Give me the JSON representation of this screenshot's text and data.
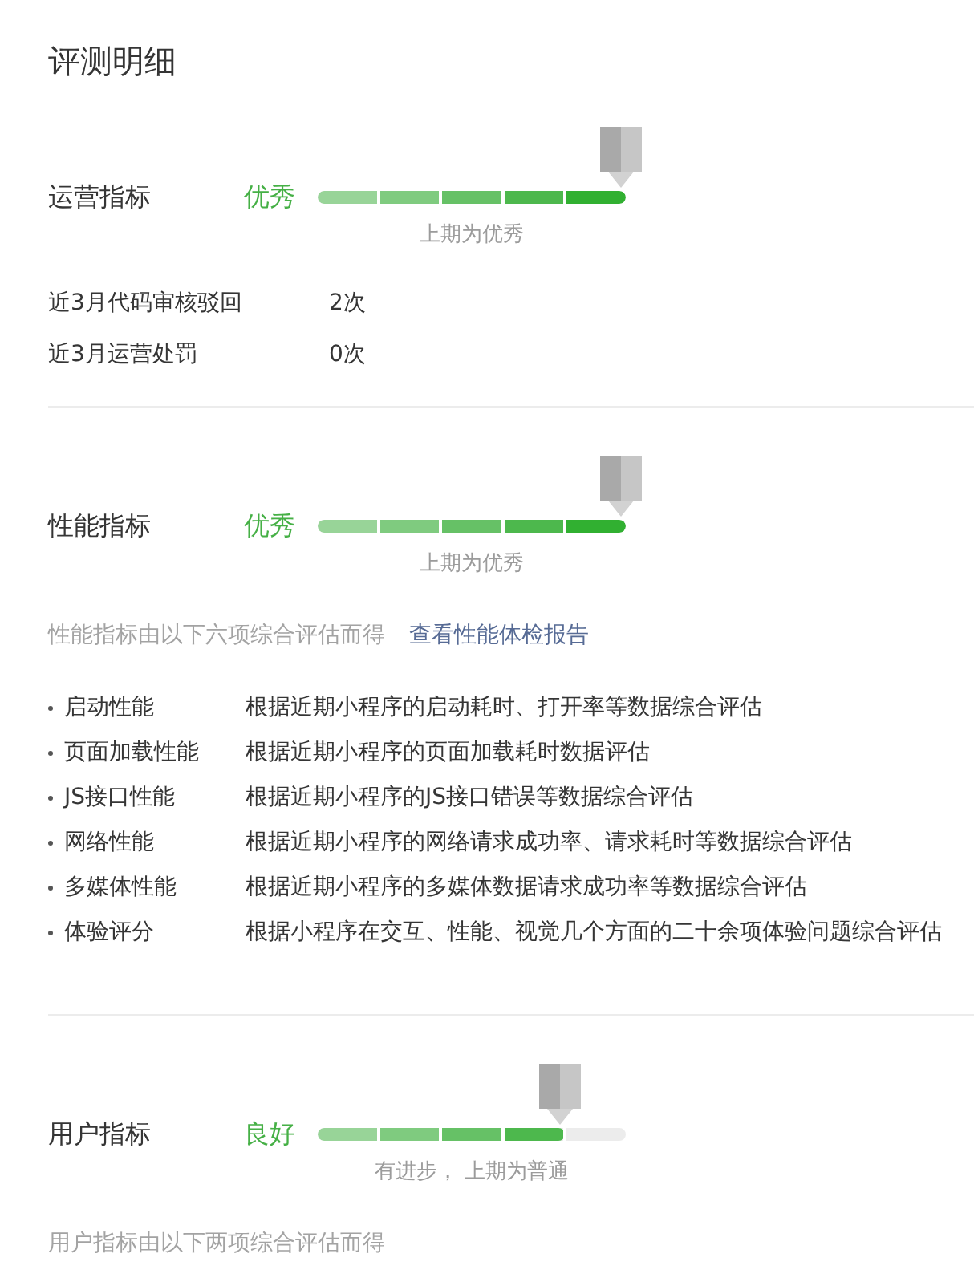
{
  "title": "评测明细",
  "sections": [
    {
      "name": "运营指标",
      "grade": "优秀",
      "level": 1,
      "note": "上期为优秀",
      "rows": [
        {
          "label": "近3月代码审核驳回",
          "value": "2次"
        },
        {
          "label": "近3月运营处罚",
          "value": "0次"
        }
      ]
    },
    {
      "name": "性能指标",
      "grade": "优秀",
      "level": 1,
      "note": "上期为优秀",
      "summary": "性能指标由以下六项综合评估而得",
      "link": "查看性能体检报告",
      "items": [
        {
          "name": "启动性能",
          "description": "根据近期小程序的启动耗时、打开率等数据综合评估"
        },
        {
          "name": "页面加载性能",
          "description": "根据近期小程序的页面加载耗时数据评估"
        },
        {
          "name": "JS接口性能",
          "description": "根据近期小程序的JS接口错误等数据综合评估"
        },
        {
          "name": "网络性能",
          "description": "根据近期小程序的网络请求成功率、请求耗时等数据综合评估"
        },
        {
          "name": "多媒体性能",
          "description": "根据近期小程序的多媒体数据请求成功率等数据综合评估"
        },
        {
          "name": "体验评分",
          "description": "根据小程序在交互、性能、视觉几个方面的二十余项体验问题综合评估"
        }
      ]
    },
    {
      "name": "用户指标",
      "grade": "良好",
      "level": 0.8,
      "note": "有进步， 上期为普通",
      "summary": "用户指标由以下两项综合评估而得"
    }
  ]
}
